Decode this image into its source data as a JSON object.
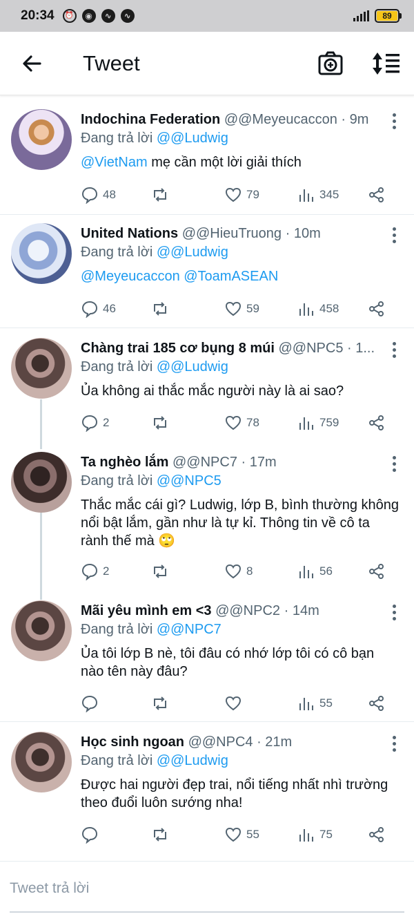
{
  "status_bar": {
    "time": "20:34",
    "battery": "89",
    "icons": [
      "alarm-icon",
      "messenger-icon",
      "messenger-icon",
      "messenger-icon"
    ]
  },
  "app_bar": {
    "title": "Tweet",
    "back_icon": "arrow-left-icon",
    "camera_icon": "camera-plus-icon",
    "sort_icon": "sort-icon"
  },
  "tweets": [
    {
      "name": "Indochina Federation",
      "handle": "@@Meyeucaccon",
      "time": "· 9m",
      "reply_prefix": "Đang trả lời ",
      "reply_to": "@@Ludwig",
      "text_mention": "@VietNam",
      "text": " mẹ cần một lời giải thích",
      "replies": "48",
      "likes": "79",
      "views": "345"
    },
    {
      "name": "United Nations",
      "handle": "@@HieuTruong",
      "time": "· 10m",
      "reply_prefix": "Đang trả lời ",
      "reply_to": "@@Ludwig",
      "text_mention": "@Meyeucaccon @ToamASEAN",
      "text": "",
      "replies": "46",
      "likes": "59",
      "views": "458"
    },
    {
      "name": "Chàng trai 185 cơ bụng 8 múi",
      "handle": "@@NPC5",
      "time": "· 1...",
      "reply_prefix": "Đang trả lời ",
      "reply_to": "@@Ludwig",
      "text_mention": "",
      "text": "Ủa không ai thắc mắc người này là ai sao?",
      "replies": "2",
      "likes": "78",
      "views": "759"
    },
    {
      "name": "Ta nghèo lắm",
      "handle": "@@NPC7",
      "time": "· 17m",
      "reply_prefix": "Đang trả lời ",
      "reply_to": "@@NPC5",
      "text_mention": "",
      "text": "Thắc mắc cái gì?  Ludwig,  lớp B,  bình thường không nổi bật lắm,  gần như là tự kỉ.  Thông tin về cô ta rành thế mà 🙄",
      "replies": "2",
      "likes": "8",
      "views": "56"
    },
    {
      "name": "Mãi yêu mình em <3",
      "handle": "@@NPC2",
      "time": "· 14m",
      "reply_prefix": "Đang trả lời ",
      "reply_to": "@@NPC7",
      "text_mention": "",
      "text": "Ủa tôi lớp B nè,  tôi đâu có nhớ lớp tôi có cô bạn nào tên này đâu?",
      "replies": "",
      "likes": "",
      "views": "55"
    },
    {
      "name": "Học sinh ngoan",
      "handle": "@@NPC4",
      "time": "· 21m",
      "reply_prefix": "Đang trả lời ",
      "reply_to": "@@Ludwig",
      "text_mention": "",
      "text": "Được hai người đẹp trai,  nổi tiếng nhất nhì trường theo đuổi luôn sướng nha!",
      "replies": "",
      "likes": "55",
      "views": "75"
    }
  ],
  "reply_box": {
    "placeholder": "Tweet trả lời"
  },
  "colors": {
    "accent": "#1d9bf0",
    "muted": "#536471",
    "status_bar": "#cfcfd1",
    "battery": "#f5c518"
  }
}
